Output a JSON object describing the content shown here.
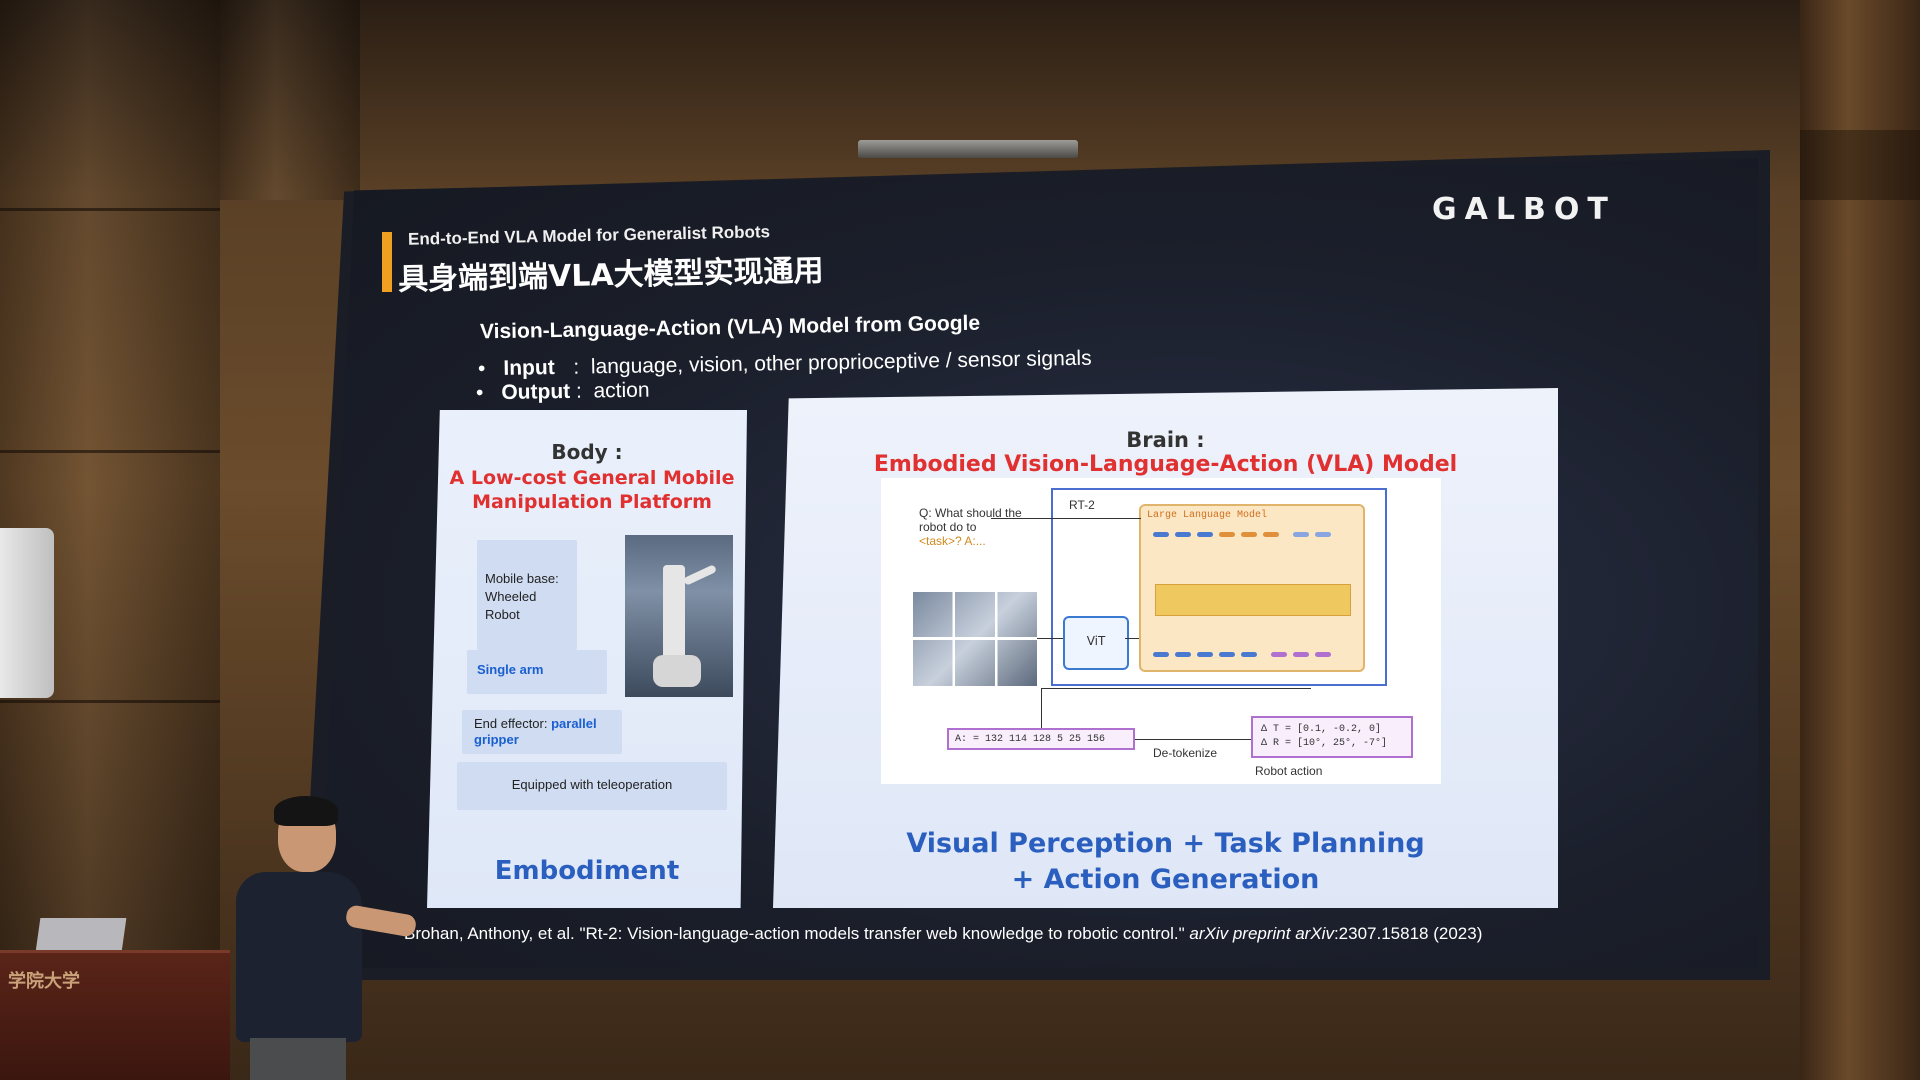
{
  "logo": "GALBOT",
  "slide": {
    "title_en": "End-to-End VLA Model for Generalist Robots",
    "title_zh": "具身端到端VLA大模型实现通用",
    "vla_heading": "Vision-Language-Action (VLA) Model from Google",
    "bullets": [
      {
        "key": "Input",
        "sep": ":",
        "value": "language, vision, other proprioceptive / sensor signals"
      },
      {
        "key": "Output",
        "sep": ":",
        "value": "action"
      }
    ],
    "body_card": {
      "heading": "Body :",
      "subtitle": "A Low-cost General Mobile Manipulation Platform",
      "mobile_base": "Mobile base: Wheeled Robot",
      "arm": "Single  arm",
      "effector_prefix": "End effector: ",
      "effector_value": "parallel gripper",
      "teleoperation": "Equipped with teleoperation",
      "footer": "Embodiment"
    },
    "brain_card": {
      "heading": "Brain :",
      "subtitle": "Embodied Vision-Language-Action (VLA) Model",
      "diagram": {
        "question": "Q: What should the robot do to",
        "task": "<task>? A:...",
        "rt2": "RT-2",
        "llm": "Large Language Model",
        "vit": "ViT",
        "action_tokens": "A: = 132 114 128 5 25 156",
        "detokenize": "De-tokenize",
        "delta_t": "Δ T = [0.1, -0.2, 0]",
        "delta_r": "Δ R = [10°, 25°, -7°]",
        "robot_action": "Robot action"
      },
      "footer_line1": "Visual Perception + Task Planning",
      "footer_line2": "+ Action Generation"
    },
    "citation_main": "Brohan, Anthony, et al. \"Rt-2: Vision-language-action models transfer web knowledge to robotic control.\" ",
    "citation_venue": "arXiv preprint arXiv",
    "citation_tail": ":2307.15818 (2023)"
  },
  "podium_text": "学院大学",
  "colors": {
    "accent_red": "#e03030",
    "accent_blue": "#2a5fbf",
    "title_bar": "#f0a020"
  }
}
